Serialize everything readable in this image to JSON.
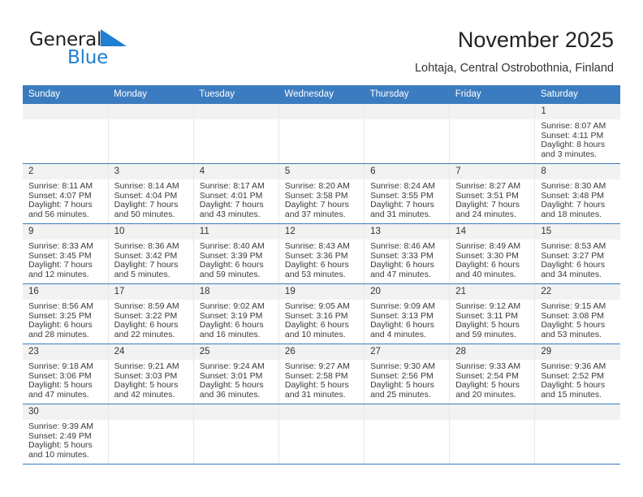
{
  "brand": {
    "word1": "General",
    "word2": "Blue",
    "triangle_color": "#1f7fd0",
    "logo_icon": "general-blue-logo"
  },
  "header": {
    "title": "November 2025",
    "subtitle": "Lohtaja, Central Ostrobothnia, Finland",
    "accent_color": "#3b7cc0"
  },
  "calendar": {
    "weekday_headers": [
      "Sunday",
      "Monday",
      "Tuesday",
      "Wednesday",
      "Thursday",
      "Friday",
      "Saturday"
    ],
    "labels": {
      "sunrise": "Sunrise:",
      "sunset": "Sunset:",
      "daylight": "Daylight:"
    },
    "weeks": [
      [
        {
          "day": "",
          "blank": true
        },
        {
          "day": "",
          "blank": true
        },
        {
          "day": "",
          "blank": true
        },
        {
          "day": "",
          "blank": true
        },
        {
          "day": "",
          "blank": true
        },
        {
          "day": "",
          "blank": true
        },
        {
          "day": "1",
          "sunrise": "Sunrise: 8:07 AM",
          "sunset": "Sunset: 4:11 PM",
          "daylight1": "Daylight: 8 hours",
          "daylight2": "and 3 minutes."
        }
      ],
      [
        {
          "day": "2",
          "sunrise": "Sunrise: 8:11 AM",
          "sunset": "Sunset: 4:07 PM",
          "daylight1": "Daylight: 7 hours",
          "daylight2": "and 56 minutes."
        },
        {
          "day": "3",
          "sunrise": "Sunrise: 8:14 AM",
          "sunset": "Sunset: 4:04 PM",
          "daylight1": "Daylight: 7 hours",
          "daylight2": "and 50 minutes."
        },
        {
          "day": "4",
          "sunrise": "Sunrise: 8:17 AM",
          "sunset": "Sunset: 4:01 PM",
          "daylight1": "Daylight: 7 hours",
          "daylight2": "and 43 minutes."
        },
        {
          "day": "5",
          "sunrise": "Sunrise: 8:20 AM",
          "sunset": "Sunset: 3:58 PM",
          "daylight1": "Daylight: 7 hours",
          "daylight2": "and 37 minutes."
        },
        {
          "day": "6",
          "sunrise": "Sunrise: 8:24 AM",
          "sunset": "Sunset: 3:55 PM",
          "daylight1": "Daylight: 7 hours",
          "daylight2": "and 31 minutes."
        },
        {
          "day": "7",
          "sunrise": "Sunrise: 8:27 AM",
          "sunset": "Sunset: 3:51 PM",
          "daylight1": "Daylight: 7 hours",
          "daylight2": "and 24 minutes."
        },
        {
          "day": "8",
          "sunrise": "Sunrise: 8:30 AM",
          "sunset": "Sunset: 3:48 PM",
          "daylight1": "Daylight: 7 hours",
          "daylight2": "and 18 minutes."
        }
      ],
      [
        {
          "day": "9",
          "sunrise": "Sunrise: 8:33 AM",
          "sunset": "Sunset: 3:45 PM",
          "daylight1": "Daylight: 7 hours",
          "daylight2": "and 12 minutes."
        },
        {
          "day": "10",
          "sunrise": "Sunrise: 8:36 AM",
          "sunset": "Sunset: 3:42 PM",
          "daylight1": "Daylight: 7 hours",
          "daylight2": "and 5 minutes."
        },
        {
          "day": "11",
          "sunrise": "Sunrise: 8:40 AM",
          "sunset": "Sunset: 3:39 PM",
          "daylight1": "Daylight: 6 hours",
          "daylight2": "and 59 minutes."
        },
        {
          "day": "12",
          "sunrise": "Sunrise: 8:43 AM",
          "sunset": "Sunset: 3:36 PM",
          "daylight1": "Daylight: 6 hours",
          "daylight2": "and 53 minutes."
        },
        {
          "day": "13",
          "sunrise": "Sunrise: 8:46 AM",
          "sunset": "Sunset: 3:33 PM",
          "daylight1": "Daylight: 6 hours",
          "daylight2": "and 47 minutes."
        },
        {
          "day": "14",
          "sunrise": "Sunrise: 8:49 AM",
          "sunset": "Sunset: 3:30 PM",
          "daylight1": "Daylight: 6 hours",
          "daylight2": "and 40 minutes."
        },
        {
          "day": "15",
          "sunrise": "Sunrise: 8:53 AM",
          "sunset": "Sunset: 3:27 PM",
          "daylight1": "Daylight: 6 hours",
          "daylight2": "and 34 minutes."
        }
      ],
      [
        {
          "day": "16",
          "sunrise": "Sunrise: 8:56 AM",
          "sunset": "Sunset: 3:25 PM",
          "daylight1": "Daylight: 6 hours",
          "daylight2": "and 28 minutes."
        },
        {
          "day": "17",
          "sunrise": "Sunrise: 8:59 AM",
          "sunset": "Sunset: 3:22 PM",
          "daylight1": "Daylight: 6 hours",
          "daylight2": "and 22 minutes."
        },
        {
          "day": "18",
          "sunrise": "Sunrise: 9:02 AM",
          "sunset": "Sunset: 3:19 PM",
          "daylight1": "Daylight: 6 hours",
          "daylight2": "and 16 minutes."
        },
        {
          "day": "19",
          "sunrise": "Sunrise: 9:05 AM",
          "sunset": "Sunset: 3:16 PM",
          "daylight1": "Daylight: 6 hours",
          "daylight2": "and 10 minutes."
        },
        {
          "day": "20",
          "sunrise": "Sunrise: 9:09 AM",
          "sunset": "Sunset: 3:13 PM",
          "daylight1": "Daylight: 6 hours",
          "daylight2": "and 4 minutes."
        },
        {
          "day": "21",
          "sunrise": "Sunrise: 9:12 AM",
          "sunset": "Sunset: 3:11 PM",
          "daylight1": "Daylight: 5 hours",
          "daylight2": "and 59 minutes."
        },
        {
          "day": "22",
          "sunrise": "Sunrise: 9:15 AM",
          "sunset": "Sunset: 3:08 PM",
          "daylight1": "Daylight: 5 hours",
          "daylight2": "and 53 minutes."
        }
      ],
      [
        {
          "day": "23",
          "sunrise": "Sunrise: 9:18 AM",
          "sunset": "Sunset: 3:06 PM",
          "daylight1": "Daylight: 5 hours",
          "daylight2": "and 47 minutes."
        },
        {
          "day": "24",
          "sunrise": "Sunrise: 9:21 AM",
          "sunset": "Sunset: 3:03 PM",
          "daylight1": "Daylight: 5 hours",
          "daylight2": "and 42 minutes."
        },
        {
          "day": "25",
          "sunrise": "Sunrise: 9:24 AM",
          "sunset": "Sunset: 3:01 PM",
          "daylight1": "Daylight: 5 hours",
          "daylight2": "and 36 minutes."
        },
        {
          "day": "26",
          "sunrise": "Sunrise: 9:27 AM",
          "sunset": "Sunset: 2:58 PM",
          "daylight1": "Daylight: 5 hours",
          "daylight2": "and 31 minutes."
        },
        {
          "day": "27",
          "sunrise": "Sunrise: 9:30 AM",
          "sunset": "Sunset: 2:56 PM",
          "daylight1": "Daylight: 5 hours",
          "daylight2": "and 25 minutes."
        },
        {
          "day": "28",
          "sunrise": "Sunrise: 9:33 AM",
          "sunset": "Sunset: 2:54 PM",
          "daylight1": "Daylight: 5 hours",
          "daylight2": "and 20 minutes."
        },
        {
          "day": "29",
          "sunrise": "Sunrise: 9:36 AM",
          "sunset": "Sunset: 2:52 PM",
          "daylight1": "Daylight: 5 hours",
          "daylight2": "and 15 minutes."
        }
      ],
      [
        {
          "day": "30",
          "sunrise": "Sunrise: 9:39 AM",
          "sunset": "Sunset: 2:49 PM",
          "daylight1": "Daylight: 5 hours",
          "daylight2": "and 10 minutes."
        },
        {
          "day": "",
          "blank": true
        },
        {
          "day": "",
          "blank": true
        },
        {
          "day": "",
          "blank": true
        },
        {
          "day": "",
          "blank": true
        },
        {
          "day": "",
          "blank": true
        },
        {
          "day": "",
          "blank": true
        }
      ]
    ]
  }
}
